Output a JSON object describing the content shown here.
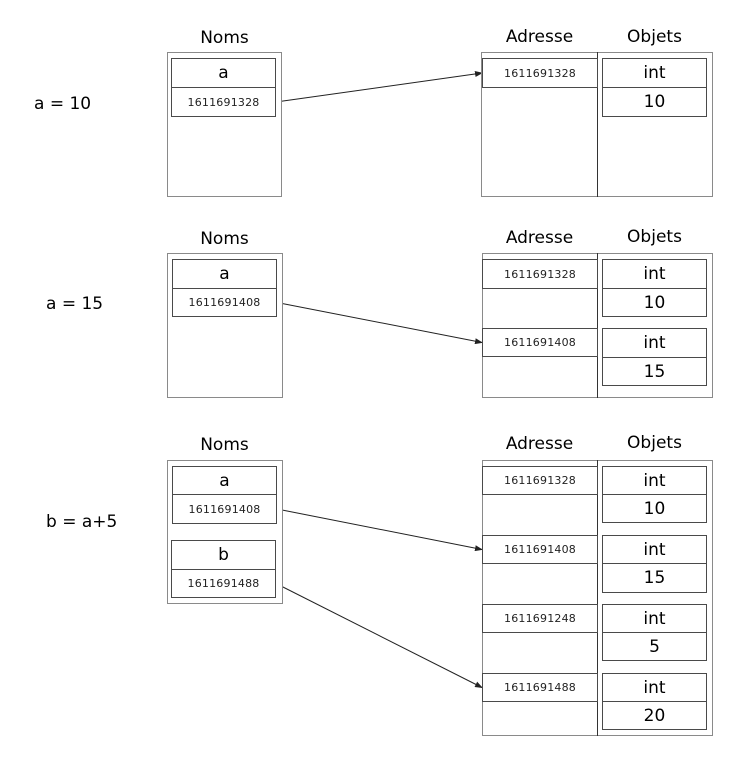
{
  "headers": {
    "names": "Noms",
    "address": "Adresse",
    "objects": "Objets"
  },
  "steps": [
    {
      "statement": "a = 10",
      "names": [
        {
          "name": "a",
          "ref": "1611691328"
        }
      ],
      "memory": [
        {
          "address": "1611691328",
          "type": "int",
          "value": "10"
        }
      ],
      "arrows": [
        {
          "from_name": "a",
          "to_address": "1611691328"
        }
      ]
    },
    {
      "statement": "a = 15",
      "names": [
        {
          "name": "a",
          "ref": "1611691408"
        }
      ],
      "memory": [
        {
          "address": "1611691328",
          "type": "int",
          "value": "10"
        },
        {
          "address": "1611691408",
          "type": "int",
          "value": "15"
        }
      ],
      "arrows": [
        {
          "from_name": "a",
          "to_address": "1611691408"
        }
      ]
    },
    {
      "statement": "b = a+5",
      "names": [
        {
          "name": "a",
          "ref": "1611691408"
        },
        {
          "name": "b",
          "ref": "1611691488"
        }
      ],
      "memory": [
        {
          "address": "1611691328",
          "type": "int",
          "value": "10"
        },
        {
          "address": "1611691408",
          "type": "int",
          "value": "15"
        },
        {
          "address": "1611691248",
          "type": "int",
          "value": "5"
        },
        {
          "address": "1611691488",
          "type": "int",
          "value": "20"
        }
      ],
      "arrows": [
        {
          "from_name": "a",
          "to_address": "1611691408"
        },
        {
          "from_name": "b",
          "to_address": "1611691488"
        }
      ]
    }
  ]
}
